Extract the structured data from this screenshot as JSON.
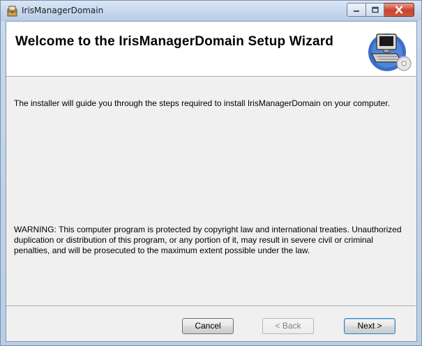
{
  "window": {
    "title": "IrisManagerDomain",
    "minimize_icon": "minimize-icon",
    "maximize_icon": "maximize-icon",
    "close_icon": "close-icon",
    "app_icon": "installer-icon"
  },
  "banner": {
    "title": "Welcome to the IrisManagerDomain Setup Wizard",
    "image_icon": "computer-disc-icon"
  },
  "body": {
    "intro": "The installer will guide you through the steps required to install IrisManagerDomain on your computer.",
    "warning": "WARNING: This computer program is protected by copyright law and international treaties. Unauthorized duplication or distribution of this program, or any portion of it, may result in severe civil or criminal penalties, and will be prosecuted to the maximum extent possible under the law."
  },
  "buttons": {
    "cancel": "Cancel",
    "back": "< Back",
    "next": "Next >"
  },
  "colors": {
    "title_bar": "#c5d7ee",
    "client_bg": "#f0f0f0",
    "close_button": "#c9432c",
    "default_button_border": "#3c7fb1"
  }
}
